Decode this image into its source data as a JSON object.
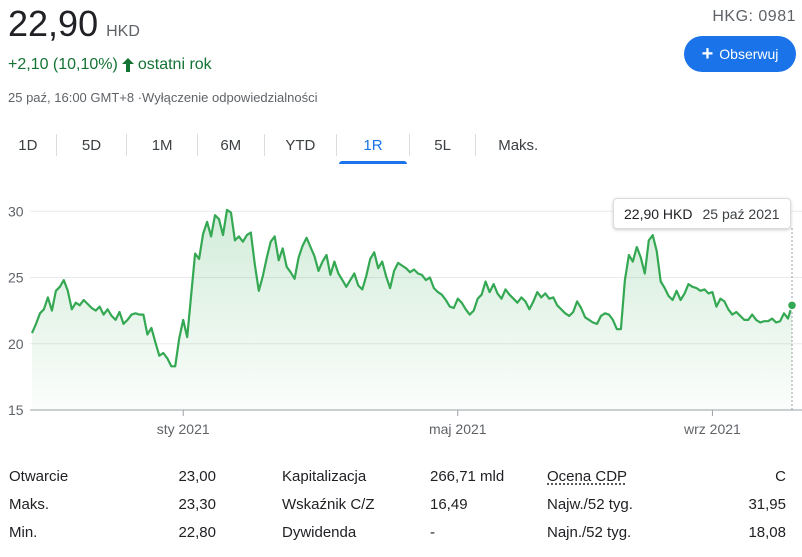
{
  "quote": {
    "price": "22,90",
    "currency": "HKD",
    "change": "+2,10 (10,10%)",
    "change_period": "ostatni rok",
    "meta": "25 paź, 16:00 GMT+8 ·Wyłączenie odpowiedzialności",
    "ticker": "HKG: 0981",
    "follow_label": "Obserwuj",
    "colors": {
      "up": "#137333",
      "accent": "#1a73e8",
      "line": "#34a853"
    }
  },
  "tabs": [
    {
      "label": "1D",
      "active": false
    },
    {
      "label": "5D",
      "active": false
    },
    {
      "label": "1M",
      "active": false
    },
    {
      "label": "6M",
      "active": false
    },
    {
      "label": "YTD",
      "active": false
    },
    {
      "label": "1R",
      "active": true
    },
    {
      "label": "5L",
      "active": false
    },
    {
      "label": "Maks.",
      "active": false
    }
  ],
  "tooltip": {
    "value": "22,90 HKD",
    "date": "25 paź 2021"
  },
  "chart_data": {
    "type": "area",
    "y_ticks": [
      "30",
      "25",
      "20",
      "15"
    ],
    "ylim": [
      15,
      31
    ],
    "x_ticks": [
      "sty 2021",
      "maj 2021",
      "wrz 2021"
    ],
    "grid": true,
    "series": [
      {
        "values": [
          20.8,
          21.5,
          22.3,
          22.6,
          23.5,
          22.5,
          24,
          24.3,
          24.8,
          24,
          22.6,
          23.1,
          22.9,
          23.3,
          23,
          22.7,
          22.5,
          22.8,
          22.2,
          22.6,
          22.1,
          21.8,
          22.4,
          21.5,
          21.8,
          22.2,
          22.3,
          22.2,
          22.2,
          20.7,
          21.2,
          20.1,
          19.1,
          19.3,
          18.9,
          18.3,
          18.3,
          20.4,
          21.8,
          20.5,
          23.7,
          26.8,
          26.4,
          28.3,
          29.2,
          28.1,
          29.7,
          29.4,
          28.2,
          30.1,
          29.9,
          27.8,
          28.1,
          27.7,
          28.2,
          28.4,
          26,
          24,
          25.1,
          26.5,
          27.7,
          28.1,
          26.3,
          27.2,
          25.8,
          25.4,
          24.9,
          26.5,
          27.4,
          28,
          27.3,
          26.6,
          25.5,
          26.2,
          26.7,
          25.2,
          26.2,
          25.3,
          24.8,
          24.3,
          24.8,
          25.3,
          24.4,
          24.1,
          25.1,
          26.4,
          26.9,
          25.7,
          26.2,
          25.1,
          24.2,
          25.5,
          26.1,
          25.9,
          25.7,
          25.4,
          25.6,
          25.3,
          25.2,
          24.8,
          25,
          24.2,
          23.9,
          23.7,
          23.3,
          22.8,
          22.7,
          23.4,
          23.1,
          22.6,
          22.2,
          22.5,
          23.4,
          23.7,
          24.7,
          23.9,
          24.5,
          23.8,
          23.4,
          24.1,
          23.7,
          23.4,
          23.1,
          23.5,
          23.2,
          22.6,
          23.2,
          23.9,
          23.5,
          23.8,
          23.4,
          23.5,
          22.9,
          22.6,
          22.3,
          22.1,
          22.4,
          23.2,
          22.7,
          22,
          21.8,
          21.6,
          21.5,
          22.1,
          22.3,
          22.2,
          21.8,
          21.1,
          21.1,
          24.8,
          26.7,
          26.2,
          27.3,
          26.5,
          25.3,
          27.8,
          28.2,
          27,
          24.7,
          24.2,
          23.6,
          23.3,
          24,
          23.3,
          23.8,
          24.5,
          24.3,
          24.2,
          24,
          24.1,
          23.8,
          23.9,
          22.8,
          23.4,
          23.2,
          22.6,
          22.2,
          22.4,
          22.1,
          21.8,
          21.8,
          22.2,
          21.8,
          21.6,
          21.7,
          21.7,
          21.9,
          21.6,
          21.7,
          22.3,
          21.9,
          22.9
        ]
      }
    ],
    "last_value": 22.9,
    "last_date": "25 paź 2021"
  },
  "stats": [
    {
      "l1": "Otwarcie",
      "v1": "23,00",
      "l2": "Kapitalizacja",
      "v2": "266,71 mld",
      "l3": "Ocena CDP",
      "v3": "C"
    },
    {
      "l1": "Maks.",
      "v1": "23,30",
      "l2": "Wskaźnik C/Z",
      "v2": "16,49",
      "l3": "Najw./52 tyg.",
      "v3": "31,95"
    },
    {
      "l1": "Min.",
      "v1": "22,80",
      "l2": "Dywidenda",
      "v2": "-",
      "l3": "Najn./52 tyg.",
      "v3": "18,08"
    }
  ]
}
